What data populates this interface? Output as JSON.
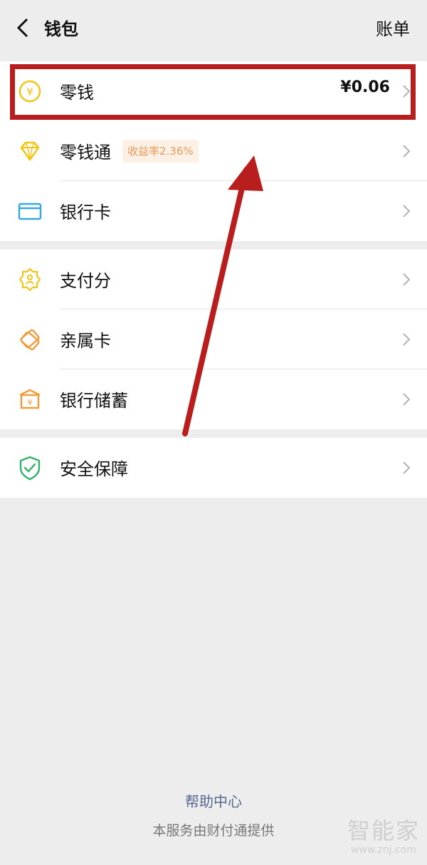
{
  "header": {
    "title": "钱包",
    "bill_label": "账单"
  },
  "groups": [
    {
      "items": [
        {
          "label": "零钱",
          "amount": "¥0.06",
          "icon": "change-coin-icon",
          "icon_color": "#f2c515"
        },
        {
          "label": "零钱通",
          "badge": "收益率2.36%",
          "icon": "diamond-icon",
          "icon_color": "#f2c515"
        },
        {
          "label": "银行卡",
          "icon": "bank-card-icon",
          "icon_color": "#3aa7e0"
        }
      ]
    },
    {
      "items": [
        {
          "label": "支付分",
          "icon": "pay-score-icon",
          "icon_color": "#f2c515"
        },
        {
          "label": "亲属卡",
          "icon": "family-card-icon",
          "icon_color": "#f29b38"
        },
        {
          "label": "银行储蓄",
          "icon": "bank-savings-icon",
          "icon_color": "#f29b38"
        }
      ]
    },
    {
      "items": [
        {
          "label": "安全保障",
          "icon": "shield-check-icon",
          "icon_color": "#2fb36a"
        }
      ]
    }
  ],
  "footer": {
    "help_link": "帮助中心",
    "provider_text": "本服务由财付通提供"
  },
  "watermark": {
    "text": "智能家",
    "url": "www.znj.com"
  },
  "colors": {
    "highlight": "#b81e1e",
    "arrow": "#b81e1e",
    "badge_text": "#e79a5a",
    "badge_bg": "#fdf0e4"
  }
}
